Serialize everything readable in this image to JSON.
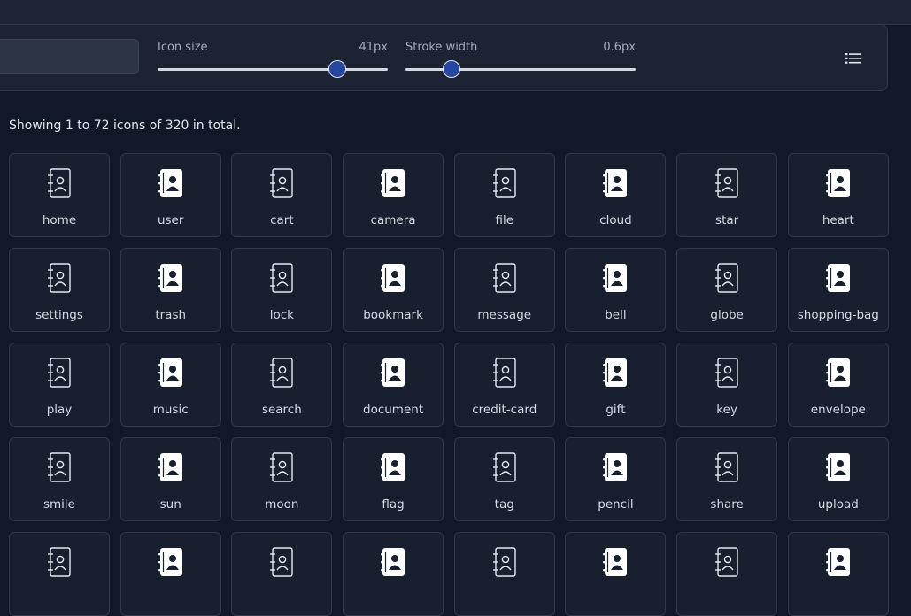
{
  "toolbar": {
    "icon_size": {
      "label": "Icon size",
      "value": "41px",
      "fraction": 0.78
    },
    "stroke_width": {
      "label": "Stroke width",
      "value": "0.6px",
      "fraction": 0.2
    },
    "view_toggle_icon": "list-icon"
  },
  "results": {
    "summary": "Showing 1 to 72 icons of 320 in total."
  },
  "icons": [
    {
      "name": "home",
      "style": "outline"
    },
    {
      "name": "user",
      "style": "filled"
    },
    {
      "name": "cart",
      "style": "outline"
    },
    {
      "name": "camera",
      "style": "filled"
    },
    {
      "name": "file",
      "style": "outline"
    },
    {
      "name": "cloud",
      "style": "filled"
    },
    {
      "name": "star",
      "style": "outline"
    },
    {
      "name": "heart",
      "style": "filled"
    },
    {
      "name": "settings",
      "style": "outline"
    },
    {
      "name": "trash",
      "style": "filled"
    },
    {
      "name": "lock",
      "style": "outline"
    },
    {
      "name": "bookmark",
      "style": "filled"
    },
    {
      "name": "message",
      "style": "outline"
    },
    {
      "name": "bell",
      "style": "filled"
    },
    {
      "name": "globe",
      "style": "outline"
    },
    {
      "name": "shopping-bag",
      "style": "filled"
    },
    {
      "name": "play",
      "style": "outline"
    },
    {
      "name": "music",
      "style": "filled"
    },
    {
      "name": "search",
      "style": "outline"
    },
    {
      "name": "document",
      "style": "filled"
    },
    {
      "name": "credit-card",
      "style": "outline"
    },
    {
      "name": "gift",
      "style": "filled"
    },
    {
      "name": "key",
      "style": "outline"
    },
    {
      "name": "envelope",
      "style": "filled"
    },
    {
      "name": "smile",
      "style": "outline"
    },
    {
      "name": "sun",
      "style": "filled"
    },
    {
      "name": "moon",
      "style": "outline"
    },
    {
      "name": "flag",
      "style": "filled"
    },
    {
      "name": "tag",
      "style": "outline"
    },
    {
      "name": "pencil",
      "style": "filled"
    },
    {
      "name": "share",
      "style": "outline"
    },
    {
      "name": "upload",
      "style": "filled"
    },
    {
      "name": "",
      "style": "outline"
    },
    {
      "name": "",
      "style": "filled"
    },
    {
      "name": "",
      "style": "outline"
    },
    {
      "name": "",
      "style": "filled"
    },
    {
      "name": "",
      "style": "outline"
    },
    {
      "name": "",
      "style": "filled"
    },
    {
      "name": "",
      "style": "outline"
    },
    {
      "name": "",
      "style": "filled"
    }
  ],
  "colors": {
    "background": "#111827",
    "card": "#182030",
    "accent": "#2746a0"
  }
}
